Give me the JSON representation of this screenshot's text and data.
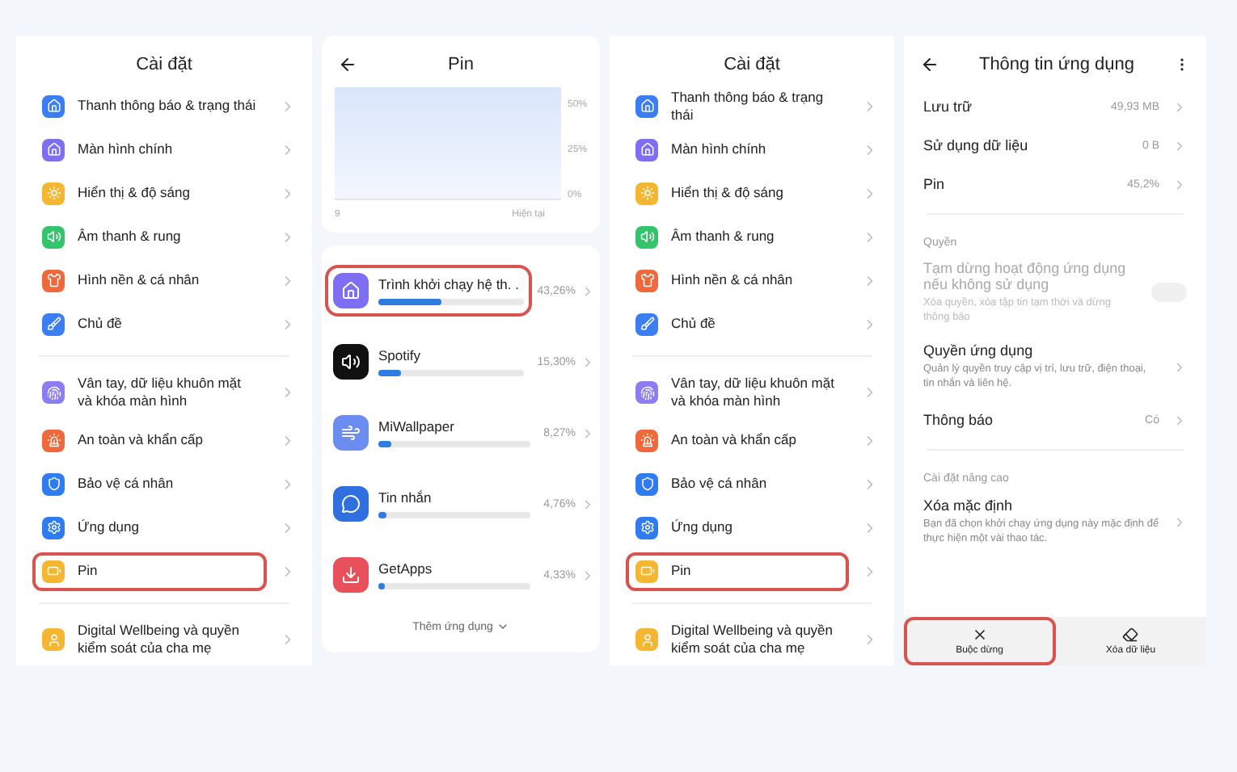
{
  "settings_screens": [
    {
      "title": "Cài đặt",
      "sections": [
        [
          {
            "label": "Thanh thông báo & trạng thái",
            "color": "#3b7df2",
            "highlighted": false
          },
          {
            "label": "Màn hình chính",
            "color": "#7d6ef2",
            "highlighted": false
          },
          {
            "label": "Hiển thị & độ sáng",
            "color": "#f5b632",
            "highlighted": false
          },
          {
            "label": "Âm thanh & rung",
            "color": "#33c46c",
            "highlighted": false
          },
          {
            "label": "Hình nền & cá nhân",
            "color": "#ee6a3c",
            "highlighted": false
          },
          {
            "label": "Chủ đề",
            "color": "#3b7df2",
            "highlighted": false
          }
        ],
        [
          {
            "label": "Vân tay, dữ liệu khuôn mặt và khóa màn hình",
            "color": "#8b7df2",
            "highlighted": false
          },
          {
            "label": "An toàn và khẩn cấp",
            "color": "#ee6a3c",
            "highlighted": false
          },
          {
            "label": "Bảo vệ cá nhân",
            "color": "#2f7cf0",
            "highlighted": false
          },
          {
            "label": "Ứng dụng",
            "color": "#2f7cf0",
            "highlighted": false
          },
          {
            "label": "Pin",
            "color": "#f5b632",
            "highlighted": true
          }
        ],
        [
          {
            "label": "Digital Wellbeing và quyền kiểm soát của cha mẹ",
            "color": "#f5b632",
            "highlighted": false
          }
        ]
      ]
    },
    {
      "title": "Cài đặt",
      "sections": [
        [
          {
            "label": "Thanh thông báo & trạng thái",
            "color": "#3b7df2",
            "highlighted": false
          },
          {
            "label": "Màn hình chính",
            "color": "#7d6ef2",
            "highlighted": false
          },
          {
            "label": "Hiển thị & độ sáng",
            "color": "#f5b632",
            "highlighted": false
          },
          {
            "label": "Âm thanh & rung",
            "color": "#33c46c",
            "highlighted": false
          },
          {
            "label": "Hình nền & cá nhân",
            "color": "#ee6a3c",
            "highlighted": false
          },
          {
            "label": "Chủ đề",
            "color": "#3b7df2",
            "highlighted": false
          }
        ],
        [
          {
            "label": "Vân tay, dữ liệu khuôn mặt và khóa màn hình",
            "color": "#8b7df2",
            "highlighted": false
          },
          {
            "label": "An toàn và khẩn cấp",
            "color": "#ee6a3c",
            "highlighted": false
          },
          {
            "label": "Bảo vệ cá nhân",
            "color": "#2f7cf0",
            "highlighted": false
          },
          {
            "label": "Ứng dụng",
            "color": "#2f7cf0",
            "highlighted": false
          },
          {
            "label": "Pin",
            "color": "#f5b632",
            "highlighted": true
          }
        ],
        [
          {
            "label": "Digital Wellbeing và quyền kiểm soát của cha mẹ",
            "color": "#f5b632",
            "highlighted": false
          }
        ]
      ]
    }
  ],
  "battery_screen": {
    "title": "Pin",
    "chart": {
      "y_labels": [
        "50%",
        "25%",
        "0%"
      ],
      "x_labels": [
        "9",
        "Hiện tại"
      ]
    },
    "apps": [
      {
        "name": "Trình khởi chạy hệ th. .",
        "percent": "43,26%",
        "level": 0.43,
        "highlighted": true,
        "color": "#7d6ef2"
      },
      {
        "name": "Spotify",
        "percent": "15,30%",
        "level": 0.15,
        "highlighted": false,
        "color": "#111111"
      },
      {
        "name": "MiWallpaper",
        "percent": "8,27%",
        "level": 0.08,
        "highlighted": false,
        "color": "#6b8df0"
      },
      {
        "name": "Tin nhắn",
        "percent": "4,76%",
        "level": 0.05,
        "highlighted": false,
        "color": "#2f6fe0"
      },
      {
        "name": "GetApps",
        "percent": "4,33%",
        "level": 0.04,
        "highlighted": false,
        "color": "#e8505b"
      }
    ],
    "more": "Thêm ứng dụng"
  },
  "app_info": {
    "title": "Thông tin ứng dụng",
    "rows": [
      {
        "kind": "value",
        "label": "Lưu trữ",
        "value": "49,93 MB"
      },
      {
        "kind": "value",
        "label": "Sử dụng dữ liệu",
        "value": "0 B"
      },
      {
        "kind": "value",
        "label": "Pin",
        "value": "45,2%"
      },
      {
        "kind": "divider"
      },
      {
        "kind": "header",
        "label": "Quyền"
      },
      {
        "kind": "toggle",
        "label": "Tạm dừng hoạt động ứng dụng nếu không sử dụng",
        "sub": "Xóa quyền, xóa tập tin tạm thời và dừng thông báo",
        "on": false,
        "disabled": true
      },
      {
        "kind": "detail",
        "label": "Quyền ứng dụng",
        "sub": "Quản lý quyền truy cập vị trí, lưu trữ, điện thoại, tin nhắn và liên hệ."
      },
      {
        "kind": "value",
        "label": "Thông báo",
        "value": "Có"
      },
      {
        "kind": "divider"
      },
      {
        "kind": "header",
        "label": "Cài đặt nâng cao"
      },
      {
        "kind": "detail",
        "label": "Xóa mặc định",
        "sub": "Bạn đã chọn khởi chạy ứng dụng này mặc định để thực hiện một vài thao tác."
      }
    ],
    "actions": [
      {
        "kind": "stop",
        "label": "Buộc dừng",
        "highlighted": true
      },
      {
        "kind": "clear",
        "label": "Xóa dữ liệu",
        "highlighted": false
      }
    ]
  }
}
